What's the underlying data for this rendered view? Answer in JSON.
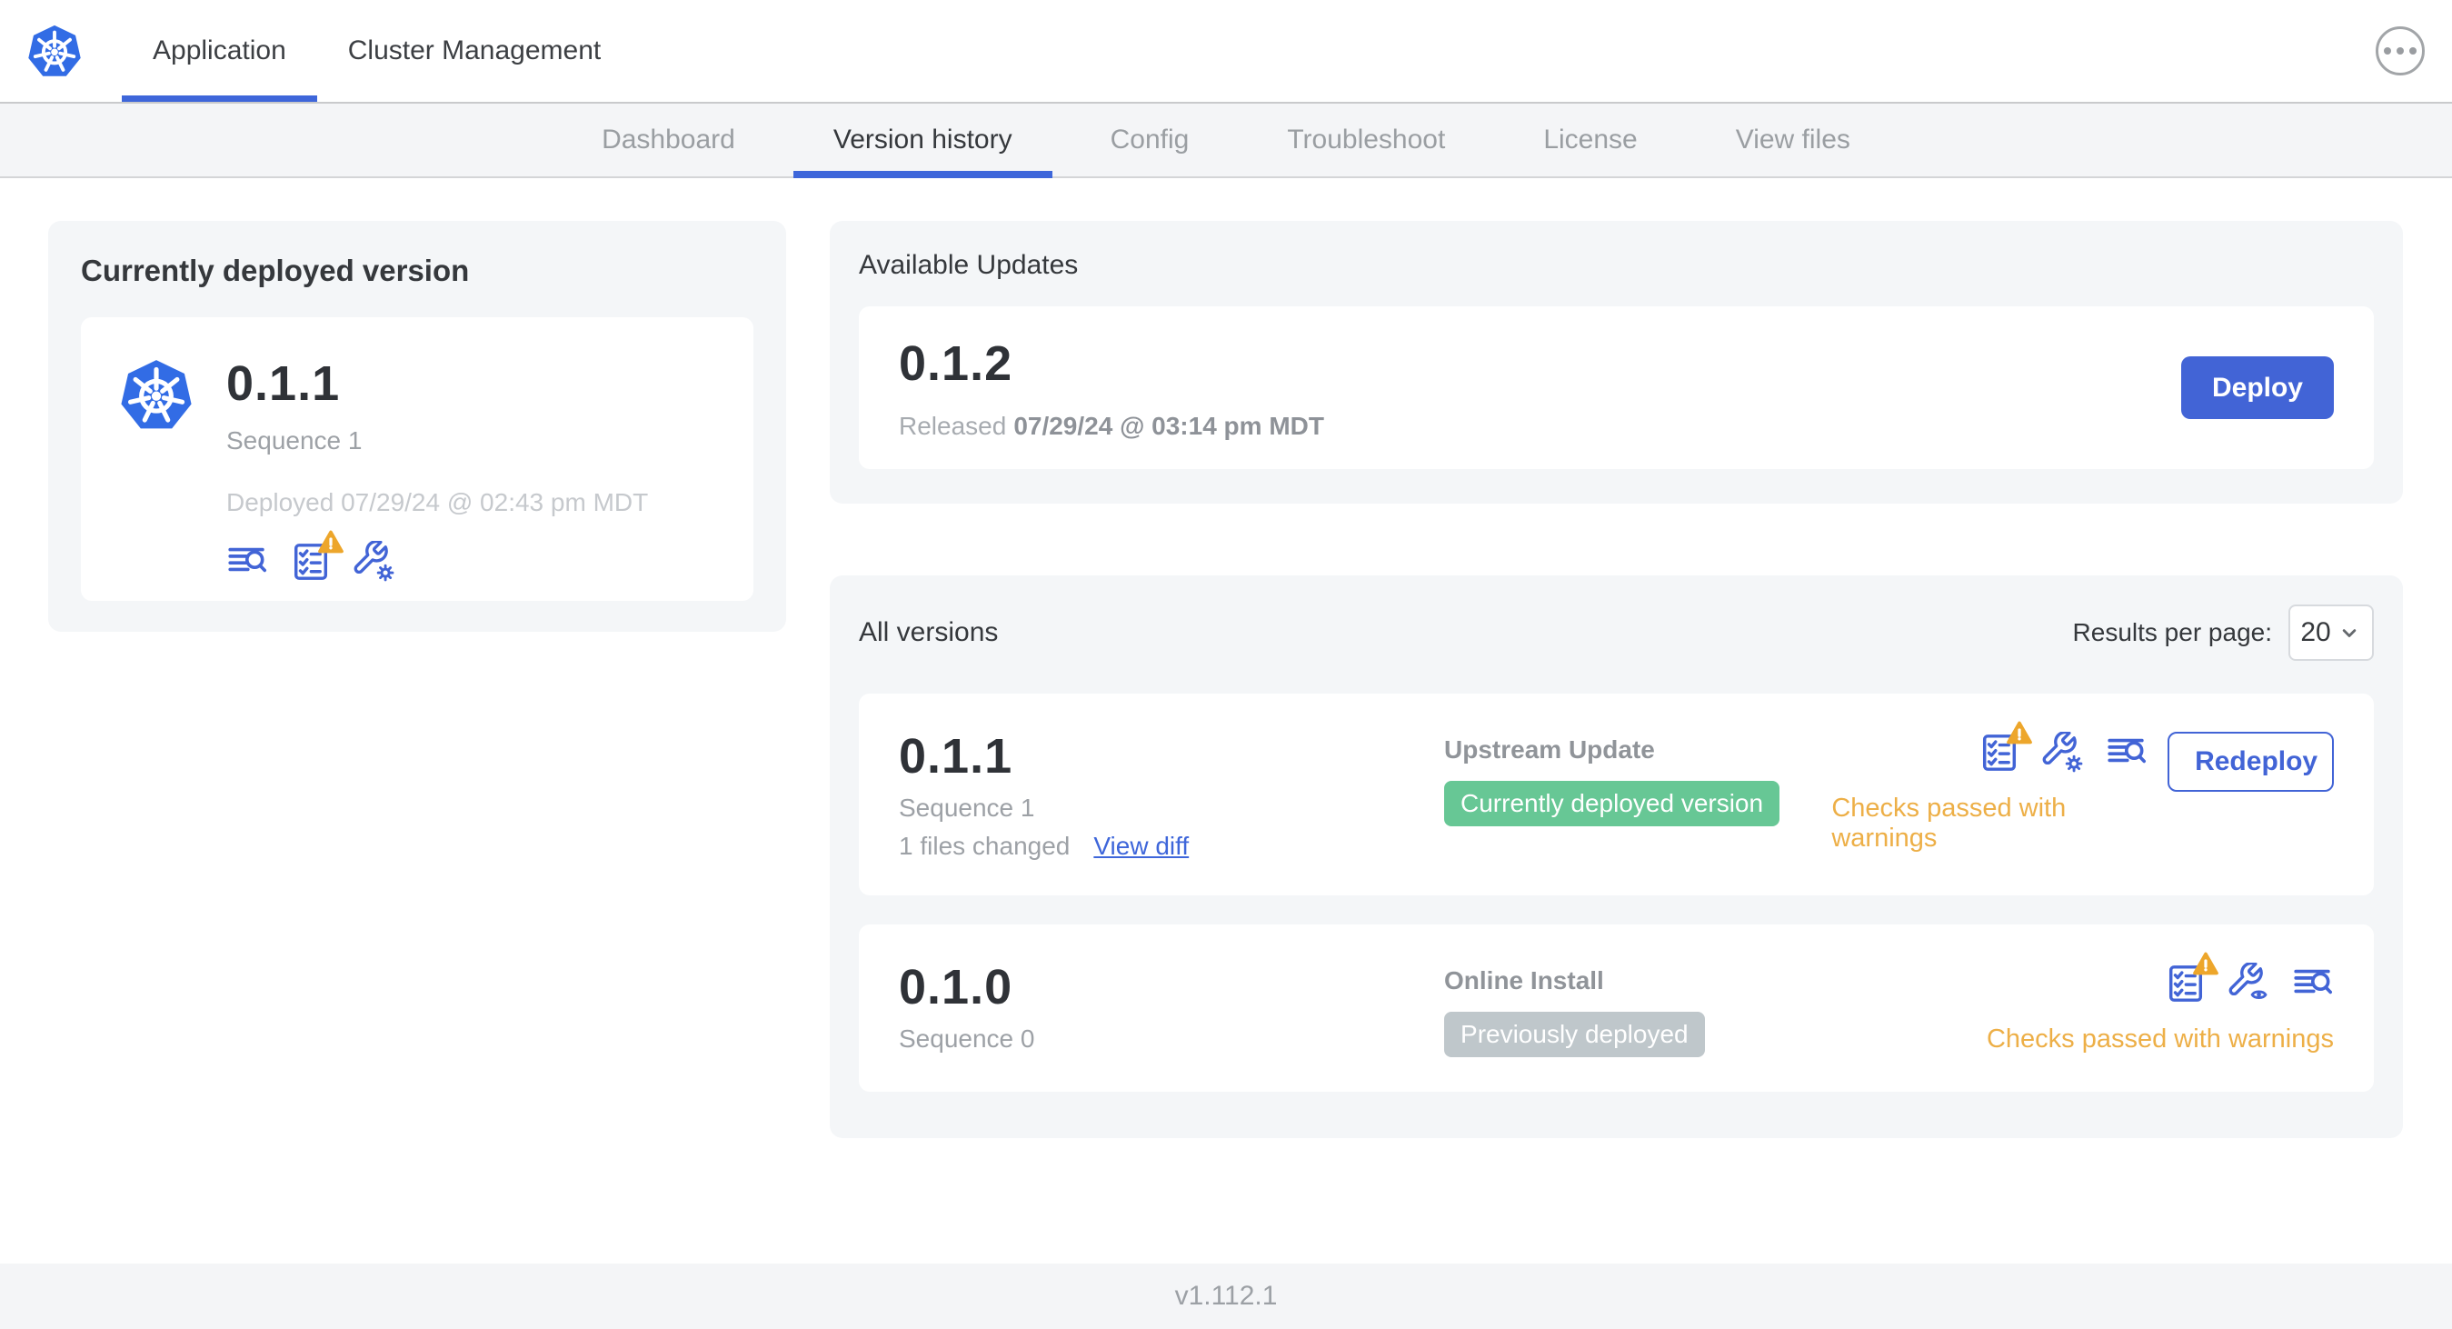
{
  "colors": {
    "accent_blue": "#4264D6",
    "kubernetes_blue": "#326CE5",
    "green_badge": "#67C795",
    "gray_badge": "#BFC7CB",
    "warning_amber": "#EDA62B",
    "warning_text": "#EDAF47",
    "card_background": "#F4F6F8"
  },
  "topnav": {
    "logo_icon": "kubernetes-logo-icon",
    "tabs": [
      {
        "label": "Application",
        "active": true
      },
      {
        "label": "Cluster Management",
        "active": false
      }
    ],
    "menu_icon": "ellipsis-menu-icon"
  },
  "subnav": {
    "tabs": [
      "Dashboard",
      "Version history",
      "Config",
      "Troubleshoot",
      "License",
      "View files"
    ],
    "active": "Version history"
  },
  "currently_deployed": {
    "title": "Currently deployed version",
    "app_icon": "kubernetes-logo-icon",
    "version": "0.1.1",
    "sequence": "Sequence 1",
    "deployed_at": "Deployed 07/29/24 @ 02:43 pm MDT",
    "icons": [
      "deploy-logs-icon",
      "preflight-checks-warning-icon",
      "edit-config-icon"
    ]
  },
  "available_updates": {
    "title": "Available Updates",
    "version": "0.1.2",
    "released_prefix": "Released",
    "released_at": "07/29/24 @ 03:14 pm MDT",
    "deploy_label": "Deploy"
  },
  "all_versions": {
    "title": "All versions",
    "results_per_page_label": "Results per page:",
    "results_per_page_value": "20",
    "rows": [
      {
        "version": "0.1.1",
        "sequence": "Sequence 1",
        "files_changed": "1 files changed",
        "view_diff_label": "View diff",
        "source": "Upstream Update",
        "status_badge": "Currently deployed version",
        "badge_style": "green",
        "icons": [
          "preflight-checks-warning-icon",
          "edit-config-icon",
          "deploy-logs-icon"
        ],
        "checks_status": "Checks passed with warnings",
        "action_label": "Redeploy"
      },
      {
        "version": "0.1.0",
        "sequence": "Sequence 0",
        "source": "Online Install",
        "status_badge": "Previously deployed",
        "badge_style": "gray",
        "icons": [
          "preflight-checks-warning-icon",
          "view-config-icon",
          "deploy-logs-icon"
        ],
        "checks_status": "Checks passed with warnings"
      }
    ]
  },
  "footer": {
    "version": "v1.112.1"
  }
}
